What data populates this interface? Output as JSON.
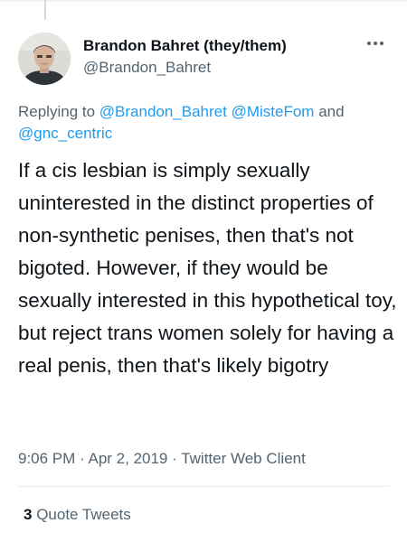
{
  "author": {
    "display_name": "Brandon Bahret (they/them)",
    "handle": "@Brandon_Bahret",
    "avatar_icon": "profile-photo"
  },
  "reply_context": {
    "prefix": "Replying to ",
    "mentions": [
      "@Brandon_Bahret",
      "@MisteFom"
    ],
    "joiner": " and",
    "last_mention": "@gnc_centric"
  },
  "tweet": {
    "text": "If a cis lesbian is simply sexually uninterested in the distinct properties of non-synthetic penises, then that's not bigoted. However, if they would be sexually interested in this hypothetical toy, but reject trans women solely for having a real penis, then that's likely bigotry"
  },
  "meta": {
    "time": "9:06 PM",
    "separator": " · ",
    "date": "Apr 2, 2019",
    "client": "Twitter Web Client"
  },
  "engagement": {
    "quote_count": "3",
    "quote_label": " Quote Tweets"
  },
  "colors": {
    "link": "#1d9bf0",
    "secondary_text": "#536471",
    "primary_text": "#0f1419"
  }
}
